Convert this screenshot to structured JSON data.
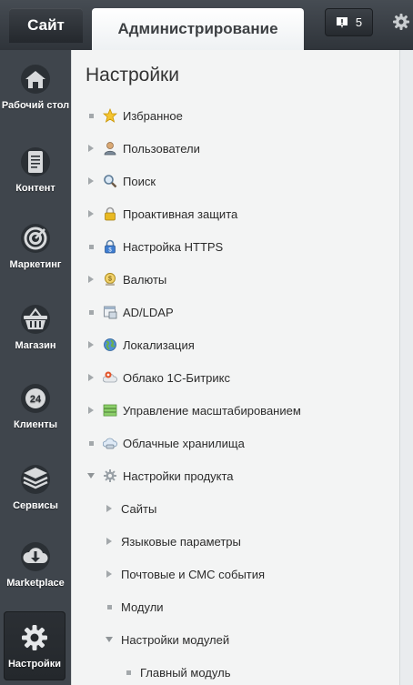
{
  "header": {
    "tab_site": "Сайт",
    "tab_admin": "Администрирование",
    "notifications_count": "5"
  },
  "nav": {
    "items": [
      {
        "label": "Рабочий стол",
        "icon": "home-icon"
      },
      {
        "label": "Контент",
        "icon": "document-icon"
      },
      {
        "label": "Маркетинг",
        "icon": "target-icon"
      },
      {
        "label": "Магазин",
        "icon": "basket-icon"
      },
      {
        "label": "Клиенты",
        "icon": "clients-24-icon"
      },
      {
        "label": "Сервисы",
        "icon": "layers-icon"
      },
      {
        "label": "Marketplace",
        "icon": "cloud-download-icon"
      },
      {
        "label": "Настройки",
        "icon": "gear-icon",
        "active": true
      }
    ]
  },
  "main": {
    "title": "Настройки",
    "tree": [
      {
        "label": "Избранное",
        "marker": "bullet",
        "icon": "star-icon"
      },
      {
        "label": "Пользователи",
        "marker": "arrow",
        "icon": "user-icon"
      },
      {
        "label": "Поиск",
        "marker": "arrow",
        "icon": "magnifier-icon"
      },
      {
        "label": "Проактивная защита",
        "marker": "arrow",
        "icon": "lock-icon"
      },
      {
        "label": "Настройка HTTPS",
        "marker": "bullet",
        "icon": "https-lock-icon"
      },
      {
        "label": "Валюты",
        "marker": "arrow",
        "icon": "currency-icon"
      },
      {
        "label": "AD/LDAP",
        "marker": "bullet",
        "icon": "ldap-icon"
      },
      {
        "label": "Локализация",
        "marker": "arrow",
        "icon": "globe-icon"
      },
      {
        "label": "Облако 1С-Битрикс",
        "marker": "arrow",
        "icon": "bitrix-cloud-icon"
      },
      {
        "label": "Управление масштабированием",
        "marker": "arrow",
        "icon": "server-icon"
      },
      {
        "label": "Облачные хранилища",
        "marker": "bullet",
        "icon": "cloud-storage-icon"
      },
      {
        "label": "Настройки продукта",
        "marker": "expanded",
        "icon": "settings-gear-icon"
      },
      {
        "label": "Сайты",
        "marker": "arrow",
        "level": 1
      },
      {
        "label": "Языковые параметры",
        "marker": "arrow",
        "level": 1
      },
      {
        "label": "Почтовые и СМС события",
        "marker": "arrow",
        "level": 1
      },
      {
        "label": "Модули",
        "marker": "bullet",
        "level": 1
      },
      {
        "label": "Настройки модулей",
        "marker": "expanded",
        "level": 1
      },
      {
        "label": "Главный модуль",
        "marker": "bullet",
        "level": 2
      }
    ]
  }
}
